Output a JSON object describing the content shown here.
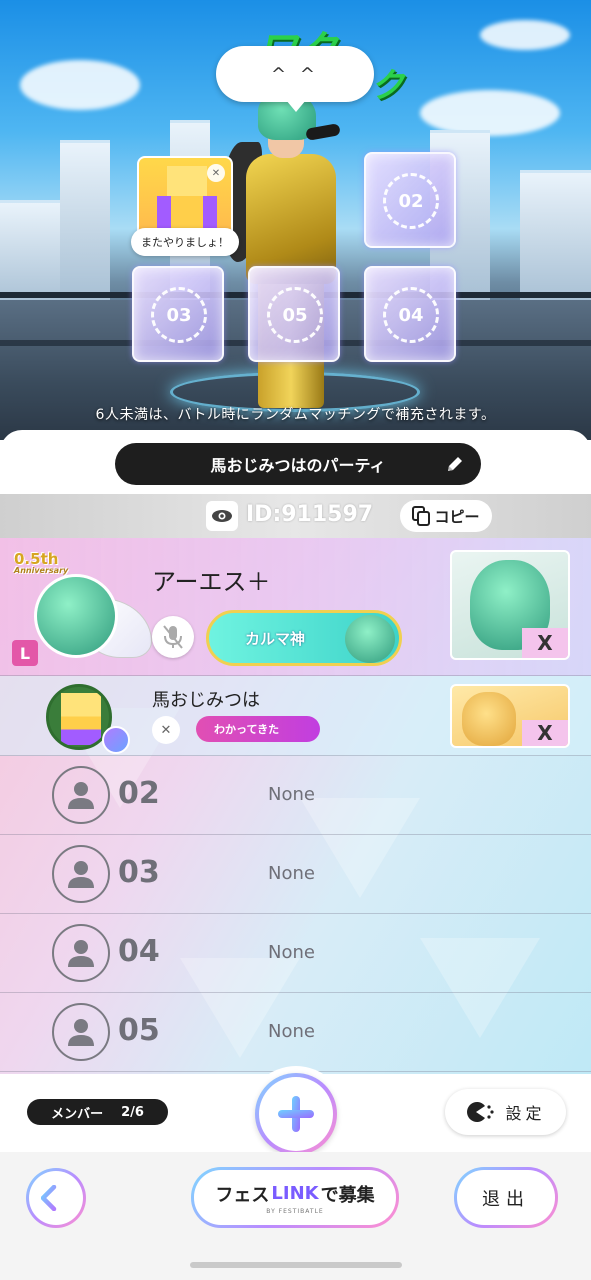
{
  "stage": {
    "bubble_text": "^ ^",
    "slot_message": "またやりましょ！",
    "slots": [
      "02",
      "03",
      "05",
      "04"
    ],
    "notice": "6人未満は、バトル時にランダムマッチングで補充されます。",
    "sticker_text": "ワク"
  },
  "party": {
    "name": "馬おじみつはのパーティ",
    "id_text": "ID:911597",
    "copy_label": "コピー"
  },
  "members": {
    "leader": {
      "name": "アーエス＋",
      "title": "カルマ神",
      "leader_mark": "L",
      "anniversary": "0.5th",
      "anniversary_sub": "Anniversary",
      "card_tag": "X"
    },
    "member": {
      "name": "馬おじみつは",
      "title": "わかってきた",
      "card_tag": "X"
    },
    "empty_slots": [
      {
        "num": "02",
        "status": "None"
      },
      {
        "num": "03",
        "status": "None"
      },
      {
        "num": "04",
        "status": "None"
      },
      {
        "num": "05",
        "status": "None"
      }
    ]
  },
  "controls": {
    "member_label": "メンバー",
    "member_count": "2/6",
    "settings_label": "設定",
    "recruit_prefix": "フェス",
    "recruit_link": "LINK",
    "recruit_suffix": "で募集",
    "recruit_sub": "BY FESTIBATLE",
    "exit_label": "退出"
  },
  "colors": {
    "accent_pink": "#e357a8",
    "accent_teal": "#3dd3c9",
    "dark": "#1e1e1e"
  }
}
